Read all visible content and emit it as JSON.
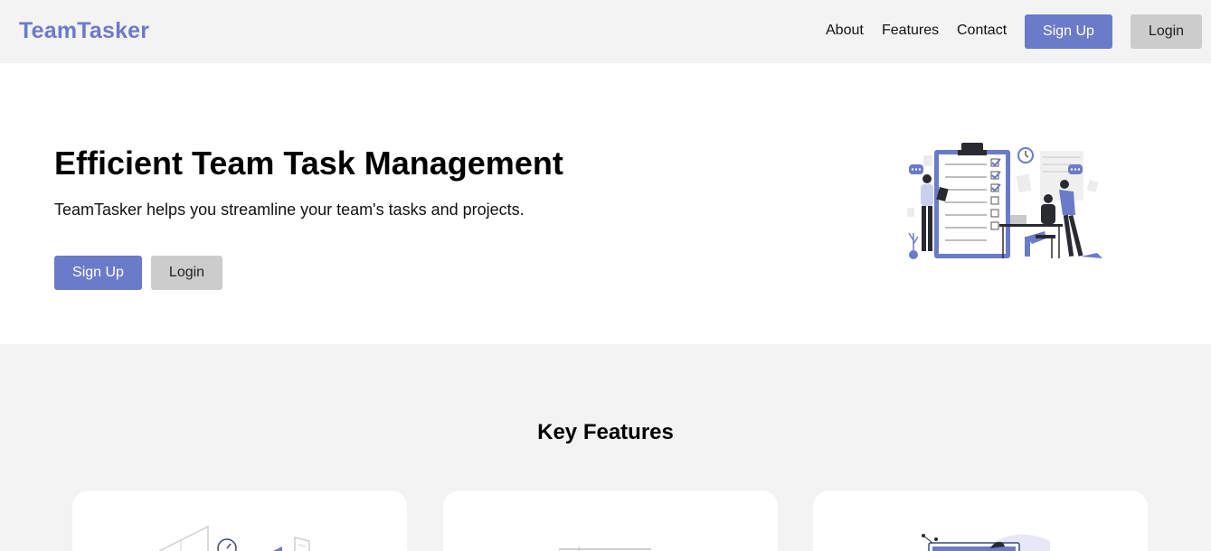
{
  "header": {
    "logo": "TeamTasker",
    "nav": [
      "About",
      "Features",
      "Contact"
    ],
    "signup_label": "Sign Up",
    "login_label": "Login"
  },
  "hero": {
    "title": "Efficient Team Task Management",
    "subtitle": "TeamTasker helps you streamline your team's tasks and projects.",
    "signup_label": "Sign Up",
    "login_label": "Login",
    "illustration": "team-task-clipboard-illustration"
  },
  "features": {
    "title": "Key Features",
    "cards": [
      {
        "icon": "workspace-illustration"
      },
      {
        "icon": "dashboard-illustration"
      },
      {
        "icon": "analytics-illustration"
      }
    ]
  },
  "colors": {
    "accent": "#6a7bc9",
    "secondary_button": "#cccccc",
    "section_bg": "#f3f3f3"
  }
}
